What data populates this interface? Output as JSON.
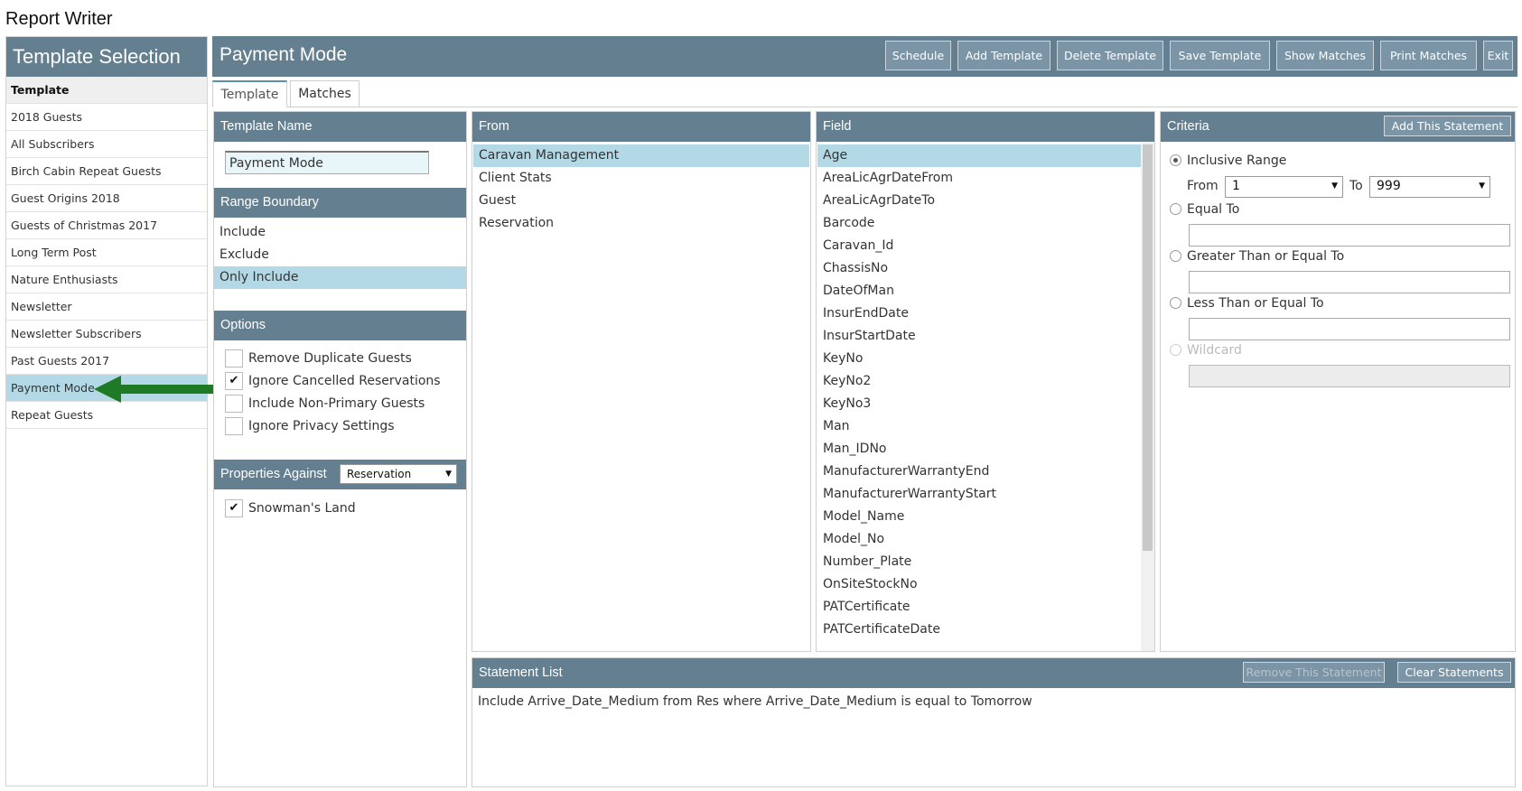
{
  "app_title": "Report Writer",
  "sidebar": {
    "title": "Template Selection",
    "items": [
      {
        "label": "Template",
        "kind": "head"
      },
      {
        "label": "2018 Guests"
      },
      {
        "label": "All Subscribers"
      },
      {
        "label": "Birch Cabin Repeat Guests"
      },
      {
        "label": "Guest Origins 2018"
      },
      {
        "label": "Guests of Christmas 2017"
      },
      {
        "label": "Long Term Post"
      },
      {
        "label": "Nature Enthusiasts"
      },
      {
        "label": "Newsletter"
      },
      {
        "label": "Newsletter Subscribers"
      },
      {
        "label": "Past Guests 2017"
      },
      {
        "label": "Payment Mode",
        "selected": true
      },
      {
        "label": "Repeat Guests"
      }
    ]
  },
  "main": {
    "title": "Payment Mode",
    "toolbar": {
      "schedule": "Schedule",
      "add_template": "Add Template",
      "delete_template": "Delete Template",
      "save_template": "Save Template",
      "show_matches": "Show Matches",
      "print_matches": "Print Matches",
      "exit": "Exit"
    },
    "tabs": {
      "template": "Template",
      "matches": "Matches",
      "active": "Template"
    }
  },
  "template_panel": {
    "name_header": "Template Name",
    "name_value": "Payment Mode",
    "range_header": "Range Boundary",
    "range_options": [
      "Include",
      "Exclude",
      "Only Include"
    ],
    "range_selected": "Only Include",
    "options_header": "Options",
    "options": [
      {
        "label": "Remove Duplicate Guests",
        "checked": false
      },
      {
        "label": "Ignore Cancelled Reservations",
        "checked": true,
        "mark": "✔"
      },
      {
        "label": "Include Non-Primary Guests",
        "checked": false
      },
      {
        "label": "Ignore Privacy Settings",
        "checked": false
      }
    ],
    "properties_header": "Properties Against",
    "properties_select": "Reservation",
    "properties": [
      {
        "label": "Snowman's Land",
        "checked": true,
        "mark": "✔"
      }
    ]
  },
  "from_panel": {
    "header": "From",
    "items": [
      "Caravan Management",
      "Client Stats",
      "Guest",
      "Reservation"
    ],
    "selected": "Caravan Management"
  },
  "field_panel": {
    "header": "Field",
    "items": [
      "Age",
      "AreaLicAgrDateFrom",
      "AreaLicAgrDateTo",
      "Barcode",
      "Caravan_Id",
      "ChassisNo",
      "DateOfMan",
      "InsurEndDate",
      "InsurStartDate",
      "KeyNo",
      "KeyNo2",
      "KeyNo3",
      "Man",
      "Man_IDNo",
      "ManufacturerWarrantyEnd",
      "ManufacturerWarrantyStart",
      "Model_Name",
      "Model_No",
      "Number_Plate",
      "OnSiteStockNo",
      "PATCertificate",
      "PATCertificateDate"
    ],
    "selected": "Age"
  },
  "criteria_panel": {
    "header": "Criteria",
    "add_button": "Add This Statement",
    "inclusive_range": "Inclusive Range",
    "from_label": "From",
    "from_value": "1",
    "to_label": "To",
    "to_value": "999",
    "equal_to": "Equal To",
    "greater_equal": "Greater Than or Equal To",
    "less_equal": "Less Than or Equal To",
    "wildcard": "Wildcard",
    "selected": "Inclusive Range"
  },
  "statement_panel": {
    "header": "Statement List",
    "remove_button": "Remove This Statement",
    "clear_button": "Clear Statements",
    "statements": [
      "Include Arrive_Date_Medium from Res where Arrive_Date_Medium is equal to Tomorrow"
    ]
  },
  "colors": {
    "header_bg": "#647f90",
    "button_bg": "#7b95a6",
    "selection_bg": "#b4d9e6",
    "arrow": "#1f7a25"
  },
  "icons": {
    "arrow": "arrow-left-icon",
    "caret": "chevron-down-icon",
    "check": "check-icon"
  }
}
